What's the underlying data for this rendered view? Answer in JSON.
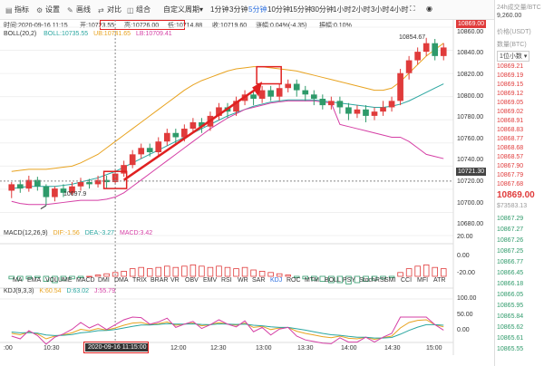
{
  "toolbar": {
    "items": [
      {
        "label": "指标",
        "icon": "indicator-icon"
      },
      {
        "label": "设置",
        "icon": "gear-icon"
      },
      {
        "label": "画线",
        "icon": "pen-icon"
      },
      {
        "label": "对比",
        "icon": "compare-icon"
      },
      {
        "label": "组合",
        "icon": "layers-icon"
      }
    ],
    "custom_period": "自定义周期",
    "periods": [
      "1分钟",
      "3分钟",
      "5分钟",
      "10分钟",
      "15分钟",
      "30分钟",
      "1小时",
      "2小时",
      "3小时",
      "4小时"
    ],
    "active_period": "5分钟",
    "fullscreen_label": "⛶",
    "camera_label": "◉"
  },
  "info": {
    "time": "时间:2020-09-16 11:15",
    "open": "开:10723.55",
    "high": "高:10726.00",
    "low": "低:10714.88",
    "close": "收:10719.60",
    "change": "涨幅:0.04%(-4.35)",
    "amplitude": "振幅:0.10%"
  },
  "boll": {
    "label": "BOLL(20,2)",
    "mid": "BOLL:10735.55",
    "ub": "UB:10741.65",
    "lb": "LB:10709.41"
  },
  "price_scale": [
    "10860.00",
    "10840.00",
    "10820.00",
    "10800.00",
    "10780.00",
    "10760.00",
    "10740.00",
    "10720.00",
    "10700.00",
    "10680.00"
  ],
  "current_price_tag": "10869.00",
  "last_price_tag": "10721.30",
  "annotations": {
    "high": "10854.67",
    "low": "10697.9"
  },
  "macd": {
    "label": "MACD(12,26,9)",
    "dif": "DIF:-1.56",
    "dea": "DEA:-3.27",
    "macd": "MACD:3.42",
    "scale": [
      "20.00",
      "0.00",
      "-20.00"
    ]
  },
  "indicator_tabs": [
    "MA",
    "EMA",
    "VOLUME",
    "MACD",
    "DMI",
    "DMA",
    "TRIX",
    "BRAR",
    "VR",
    "OBV",
    "EMV",
    "RSI",
    "WR",
    "SAR",
    "KDJ",
    "ROC",
    "MTM",
    "BOLL",
    "PSY",
    "StochRSI",
    "SMI",
    "CCI",
    "MFI",
    "ATR"
  ],
  "active_indicator": "KDJ",
  "kdj": {
    "label": "KDJ(9,3,3)",
    "k": "K:60.54",
    "d": "D:63.02",
    "j": "J:55.79",
    "scale": [
      "100.00",
      "50.00",
      "0.00"
    ]
  },
  "time_axis": {
    "labels": [
      ":00",
      "10:30",
      "12:00",
      "12:30",
      "13:00",
      "13:30",
      "14:00",
      "14:30",
      "15:00"
    ],
    "highlight": "2020-09-16 11:15:00"
  },
  "right_panel": {
    "top": [
      "24h成交量/BTC",
      "9,260.00",
      "价格(USDT)",
      "数量(BTC)"
    ],
    "depth_label": "1位小数",
    "asks": [
      "10869.21",
      "10869.19",
      "10869.15",
      "10869.12",
      "10869.05",
      "10869.02",
      "10868.91",
      "10868.83",
      "10868.77",
      "10868.68",
      "10868.57",
      "10867.90",
      "10867.79",
      "10867.68"
    ],
    "mid_price": "10869.00",
    "mid_sub": "$73583.13",
    "bids": [
      "10867.29",
      "10867.27",
      "10867.26",
      "10867.25",
      "10866.77",
      "10866.45",
      "10866.18",
      "10866.05",
      "10865.95",
      "10865.84",
      "10865.62",
      "10865.61",
      "10865.55"
    ]
  },
  "colors": {
    "up": "#e03b3b",
    "down": "#2e9a6a",
    "mid": "#2aa6a0",
    "ub": "#e8a320",
    "lb": "#d53fa5",
    "accent": "#2b6fe0",
    "annot": "#e02020"
  },
  "chart_data": {
    "type": "candlestick",
    "candles": [
      [
        10712,
        10718,
        10705,
        10720
      ],
      [
        10718,
        10714,
        10710,
        10722
      ],
      [
        10714,
        10722,
        10711,
        10726
      ],
      [
        10722,
        10716,
        10712,
        10725
      ],
      [
        10716,
        10706,
        10698,
        10718
      ],
      [
        10706,
        10714,
        10702,
        10716
      ],
      [
        10714,
        10710,
        10706,
        10718
      ],
      [
        10710,
        10716,
        10708,
        10720
      ],
      [
        10716,
        10720,
        10712,
        10724
      ],
      [
        10720,
        10718,
        10714,
        10723
      ],
      [
        10718,
        10722,
        10715,
        10726
      ],
      [
        10722,
        10720,
        10714,
        10726
      ],
      [
        10720,
        10728,
        10718,
        10732
      ],
      [
        10728,
        10736,
        10725,
        10740
      ],
      [
        10736,
        10746,
        10733,
        10750
      ],
      [
        10746,
        10752,
        10742,
        10756
      ],
      [
        10752,
        10748,
        10744,
        10756
      ],
      [
        10748,
        10758,
        10745,
        10762
      ],
      [
        10758,
        10766,
        10754,
        10770
      ],
      [
        10766,
        10762,
        10756,
        10770
      ],
      [
        10762,
        10770,
        10758,
        10774
      ],
      [
        10770,
        10776,
        10766,
        10780
      ],
      [
        10776,
        10772,
        10766,
        10780
      ],
      [
        10772,
        10782,
        10768,
        10786
      ],
      [
        10782,
        10790,
        10778,
        10794
      ],
      [
        10790,
        10786,
        10780,
        10794
      ],
      [
        10786,
        10796,
        10782,
        10800
      ],
      [
        10796,
        10802,
        10792,
        10806
      ],
      [
        10802,
        10798,
        10792,
        10806
      ],
      [
        10798,
        10806,
        10794,
        10810
      ],
      [
        10806,
        10800,
        10796,
        10810
      ],
      [
        10800,
        10808,
        10796,
        10812
      ],
      [
        10808,
        10812,
        10804,
        10816
      ],
      [
        10812,
        10806,
        10800,
        10816
      ],
      [
        10806,
        10802,
        10796,
        10810
      ],
      [
        10802,
        10798,
        10792,
        10806
      ],
      [
        10798,
        10792,
        10788,
        10802
      ],
      [
        10792,
        10796,
        10788,
        10800
      ],
      [
        10796,
        10790,
        10784,
        10800
      ],
      [
        10790,
        10784,
        10778,
        10794
      ],
      [
        10784,
        10788,
        10780,
        10792
      ],
      [
        10788,
        10782,
        10776,
        10792
      ],
      [
        10782,
        10786,
        10778,
        10790
      ],
      [
        10786,
        10790,
        10782,
        10796
      ],
      [
        10790,
        10796,
        10786,
        10800
      ],
      [
        10796,
        10822,
        10792,
        10826
      ],
      [
        10822,
        10834,
        10816,
        10838
      ],
      [
        10834,
        10842,
        10830,
        10846
      ],
      [
        10842,
        10850,
        10838,
        10855
      ],
      [
        10850,
        10838,
        10834,
        10854
      ],
      [
        10838,
        10846,
        10834,
        10850
      ]
    ],
    "ylim": [
      10670,
      10865
    ],
    "boll_mid": [
      10714,
      10715,
      10716,
      10716,
      10716,
      10716,
      10717,
      10718,
      10720,
      10722,
      10724,
      10727,
      10730,
      10734,
      10738,
      10742,
      10746,
      10750,
      10754,
      10758,
      10762,
      10766,
      10770,
      10774,
      10778,
      10782,
      10785,
      10788,
      10791,
      10793,
      10795,
      10796,
      10797,
      10797,
      10797,
      10797,
      10796,
      10795,
      10794,
      10793,
      10792,
      10791,
      10790,
      10790,
      10791,
      10793,
      10796,
      10800,
      10804,
      10808,
      10812
    ],
    "boll_ub": [
      10730,
      10731,
      10732,
      10732,
      10732,
      10733,
      10734,
      10735,
      10738,
      10742,
      10746,
      10752,
      10758,
      10764,
      10770,
      10776,
      10782,
      10788,
      10794,
      10800,
      10806,
      10811,
      10815,
      10818,
      10821,
      10824,
      10826,
      10827,
      10828,
      10828,
      10827,
      10826,
      10825,
      10824,
      10822,
      10820,
      10818,
      10816,
      10814,
      10812,
      10810,
      10808,
      10806,
      10806,
      10808,
      10814,
      10822,
      10830,
      10838,
      10844,
      10850
    ],
    "boll_lb": [
      10702,
      10700,
      10699,
      10699,
      10699,
      10700,
      10701,
      10702,
      10703,
      10703,
      10703,
      10704,
      10706,
      10710,
      10716,
      10722,
      10728,
      10734,
      10740,
      10746,
      10752,
      10758,
      10764,
      10770,
      10775,
      10780,
      10784,
      10788,
      10790,
      10792,
      10794,
      10795,
      10796,
      10796,
      10796,
      10796,
      10795,
      10794,
      10774,
      10772,
      10770,
      10768,
      10766,
      10764,
      10762,
      10762,
      10758,
      10752,
      10746,
      10744,
      10742
    ],
    "macd_hist": [
      -2,
      -3,
      -2,
      -1,
      -4,
      -5,
      -3,
      -2,
      -1,
      0,
      1,
      2,
      3,
      4,
      6,
      7,
      6,
      7,
      8,
      7,
      8,
      9,
      8,
      7,
      8,
      7,
      6,
      7,
      5,
      4,
      3,
      2,
      1,
      -1,
      -2,
      -3,
      -4,
      -5,
      -5,
      -6,
      -5,
      -4,
      -3,
      -2,
      -1,
      3,
      6,
      8,
      9,
      7,
      6
    ],
    "kdj_k": [
      40,
      35,
      45,
      38,
      20,
      30,
      35,
      42,
      55,
      50,
      58,
      52,
      60,
      70,
      78,
      80,
      72,
      76,
      82,
      70,
      74,
      78,
      68,
      72,
      80,
      74,
      70,
      78,
      62,
      66,
      54,
      60,
      62,
      48,
      40,
      34,
      28,
      24,
      30,
      22,
      20,
      26,
      18,
      24,
      30,
      60,
      80,
      88,
      90,
      72,
      64
    ],
    "kdj_d": [
      45,
      42,
      43,
      41,
      34,
      32,
      33,
      36,
      42,
      45,
      50,
      51,
      54,
      60,
      66,
      71,
      71,
      73,
      76,
      74,
      74,
      75,
      73,
      72,
      75,
      74,
      73,
      74,
      70,
      68,
      64,
      62,
      62,
      57,
      52,
      46,
      40,
      35,
      33,
      29,
      26,
      26,
      23,
      23,
      25,
      37,
      51,
      63,
      72,
      72,
      70
    ],
    "kdj_j": [
      30,
      20,
      50,
      32,
      0,
      26,
      38,
      55,
      80,
      60,
      74,
      54,
      72,
      90,
      100,
      98,
      74,
      82,
      96,
      62,
      74,
      84,
      58,
      72,
      90,
      74,
      64,
      86,
      46,
      62,
      34,
      56,
      62,
      30,
      16,
      10,
      4,
      2,
      24,
      8,
      8,
      26,
      8,
      26,
      40,
      100,
      100,
      100,
      100,
      72,
      52
    ]
  }
}
